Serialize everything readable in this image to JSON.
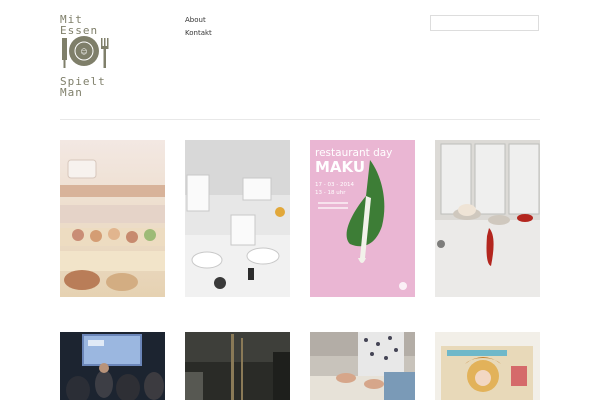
{
  "logo": {
    "line1": "Mit Essen",
    "line3": "Spielt Man",
    "icons": [
      "fork-icon",
      "plate-icon",
      "knife-icon"
    ]
  },
  "nav": {
    "items": [
      {
        "label": "About"
      },
      {
        "label": "Kontakt"
      }
    ]
  },
  "search": {
    "placeholder": "",
    "value": ""
  },
  "colors": {
    "accent_pink": "#eab6d3",
    "text": "#333333",
    "logo_ink": "#7f7f6a",
    "rule": "#e8e8e8"
  },
  "gallery": {
    "row1": [
      {
        "subject": "buffet"
      },
      {
        "subject": "smacznego-table"
      },
      {
        "poster_title": "restaurant day",
        "poster_name": "MAKU",
        "poster_date": "17 - 03 - 2014",
        "poster_time": "13 - 18 uhr"
      },
      {
        "subject": "lockers-food"
      }
    ],
    "row2": [
      {
        "subject": "presentation"
      },
      {
        "subject": "dark-room"
      },
      {
        "subject": "hands-preparing"
      },
      {
        "subject": "magazine"
      }
    ]
  }
}
